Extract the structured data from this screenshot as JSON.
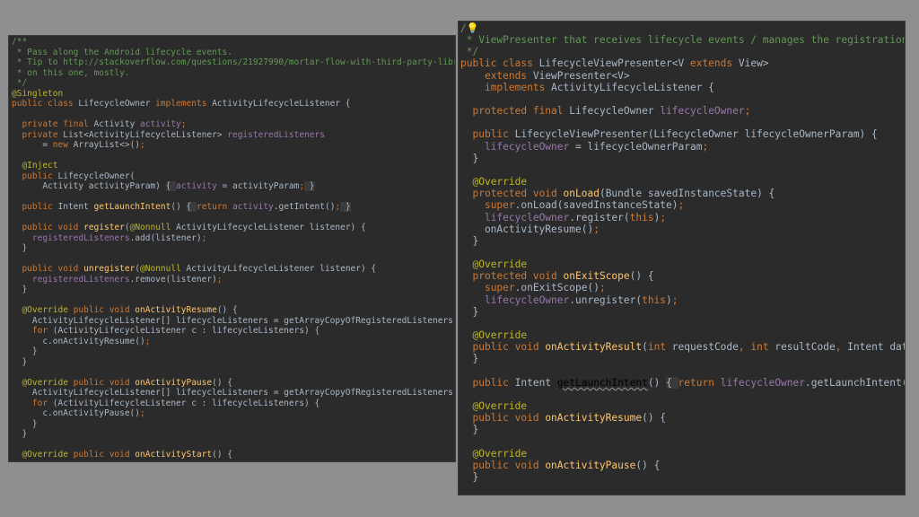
{
  "left": {
    "lines": [
      [
        [
          "/**",
          "cm"
        ]
      ],
      [
        [
          " * Pass along the Android lifecycle events.",
          "cm"
        ]
      ],
      [
        [
          " * Tip to http://stackoverflow.com/questions/21927990/mortar-flow-with-third-party-librarie",
          "cm"
        ]
      ],
      [
        [
          " * on this one, mostly.",
          "cm"
        ]
      ],
      [
        [
          " */",
          "cm"
        ]
      ],
      [
        [
          "@Singleton",
          "an"
        ]
      ],
      [
        [
          "public class ",
          "kw"
        ],
        [
          "LifecycleOwner ",
          "tx"
        ],
        [
          "implements ",
          "kw"
        ],
        [
          "ActivityLifecycleListener {",
          "tx"
        ]
      ],
      [
        [
          "",
          "tx"
        ]
      ],
      [
        [
          "  ",
          "tx"
        ],
        [
          "private final ",
          "kw"
        ],
        [
          "Activity ",
          "tx"
        ],
        [
          "activity",
          "fd"
        ],
        [
          ";",
          "kw"
        ]
      ],
      [
        [
          "  ",
          "tx"
        ],
        [
          "private ",
          "kw"
        ],
        [
          "List<ActivityLifecycleListener> ",
          "tx"
        ],
        [
          "registeredListeners",
          "fd"
        ]
      ],
      [
        [
          "      = ",
          "tx"
        ],
        [
          "new ",
          "kw"
        ],
        [
          "ArrayList<>()",
          "tx"
        ],
        [
          ";",
          "kw"
        ]
      ],
      [
        [
          "",
          "tx"
        ]
      ],
      [
        [
          "  ",
          "tx"
        ],
        [
          "@Inject",
          "an"
        ]
      ],
      [
        [
          "  ",
          "tx"
        ],
        [
          "public ",
          "kw"
        ],
        [
          "LifecycleOwner(",
          "tx"
        ]
      ],
      [
        [
          "      Activity activityParam) ",
          "tx"
        ],
        [
          "{ ",
          "fold"
        ],
        [
          "activity",
          "fd"
        ],
        [
          " = activityParam",
          "tx"
        ],
        [
          ";",
          "kw"
        ],
        [
          " }",
          "fold"
        ]
      ],
      [
        [
          "",
          "tx"
        ]
      ],
      [
        [
          "  ",
          "tx"
        ],
        [
          "public ",
          "kw"
        ],
        [
          "Intent ",
          "tx"
        ],
        [
          "getLaunchIntent",
          "fn"
        ],
        [
          "() ",
          "tx"
        ],
        [
          "{ ",
          "fold"
        ],
        [
          "return ",
          "kw"
        ],
        [
          "activity",
          "fd"
        ],
        [
          ".getIntent()",
          "tx"
        ],
        [
          ";",
          "kw"
        ],
        [
          " }",
          "fold"
        ]
      ],
      [
        [
          "",
          "tx"
        ]
      ],
      [
        [
          "  ",
          "tx"
        ],
        [
          "public void ",
          "kw"
        ],
        [
          "register",
          "fn"
        ],
        [
          "(",
          "tx"
        ],
        [
          "@Nonnull ",
          "an"
        ],
        [
          "ActivityLifecycleListener listener) {",
          "tx"
        ]
      ],
      [
        [
          "    ",
          "tx"
        ],
        [
          "registeredListeners",
          "fd"
        ],
        [
          ".add(listener)",
          "tx"
        ],
        [
          ";",
          "kw"
        ]
      ],
      [
        [
          "  }",
          "tx"
        ]
      ],
      [
        [
          "",
          "tx"
        ]
      ],
      [
        [
          "  ",
          "tx"
        ],
        [
          "public void ",
          "kw"
        ],
        [
          "unregister",
          "fn"
        ],
        [
          "(",
          "tx"
        ],
        [
          "@Nonnull ",
          "an"
        ],
        [
          "ActivityLifecycleListener listener) {",
          "tx"
        ]
      ],
      [
        [
          "    ",
          "tx"
        ],
        [
          "registeredListeners",
          "fd"
        ],
        [
          ".remove(listener)",
          "tx"
        ],
        [
          ";",
          "kw"
        ]
      ],
      [
        [
          "  }",
          "tx"
        ]
      ],
      [
        [
          "",
          "tx"
        ]
      ],
      [
        [
          "  ",
          "tx"
        ],
        [
          "@Override ",
          "an"
        ],
        [
          "public void ",
          "kw"
        ],
        [
          "onActivityResume",
          "fn"
        ],
        [
          "() {",
          "tx"
        ]
      ],
      [
        [
          "    ActivityLifecycleListener[] lifecycleListeners = getArrayCopyOfRegisteredListeners()",
          "tx"
        ],
        [
          ";",
          "kw"
        ]
      ],
      [
        [
          "    ",
          "tx"
        ],
        [
          "for ",
          "kw"
        ],
        [
          "(ActivityLifecycleListener c : lifecycleListeners) {",
          "tx"
        ]
      ],
      [
        [
          "      c.onActivityResume()",
          "tx"
        ],
        [
          ";",
          "kw"
        ]
      ],
      [
        [
          "    }",
          "tx"
        ]
      ],
      [
        [
          "  }",
          "tx"
        ]
      ],
      [
        [
          "",
          "tx"
        ]
      ],
      [
        [
          "  ",
          "tx"
        ],
        [
          "@Override ",
          "an"
        ],
        [
          "public void ",
          "kw"
        ],
        [
          "onActivityPause",
          "fn"
        ],
        [
          "() {",
          "tx"
        ]
      ],
      [
        [
          "    ActivityLifecycleListener[] lifecycleListeners = getArrayCopyOfRegisteredListeners()",
          "tx"
        ],
        [
          ";",
          "kw"
        ]
      ],
      [
        [
          "    ",
          "tx"
        ],
        [
          "for ",
          "kw"
        ],
        [
          "(ActivityLifecycleListener c : lifecycleListeners) {",
          "tx"
        ]
      ],
      [
        [
          "      c.onActivityPause()",
          "tx"
        ],
        [
          ";",
          "kw"
        ]
      ],
      [
        [
          "    }",
          "tx"
        ]
      ],
      [
        [
          "  }",
          "tx"
        ]
      ],
      [
        [
          "",
          "tx"
        ]
      ],
      [
        [
          "  ",
          "tx"
        ],
        [
          "@Override ",
          "an"
        ],
        [
          "public void ",
          "kw"
        ],
        [
          "onActivityStart",
          "fn"
        ],
        [
          "() {",
          "tx"
        ]
      ]
    ]
  },
  "right": {
    "lines": [
      [
        [
          "/",
          "cm"
        ],
        [
          "💡",
          "bulb"
        ]
      ],
      [
        [
          " * ViewPresenter that receives lifecycle events / manages the registration",
          "cm"
        ],
        [
          "",
          "caret"
        ]
      ],
      [
        [
          " */",
          "cm"
        ]
      ],
      [
        [
          "public class ",
          "kw"
        ],
        [
          "LifecycleViewPresenter<",
          "tx"
        ],
        [
          "V ",
          "ty"
        ],
        [
          "extends ",
          "kw"
        ],
        [
          "View>",
          "tx"
        ]
      ],
      [
        [
          "    ",
          "tx"
        ],
        [
          "extends ",
          "kw"
        ],
        [
          "ViewPresenter<",
          "tx"
        ],
        [
          "V",
          "ty"
        ],
        [
          ">",
          "tx"
        ]
      ],
      [
        [
          "    ",
          "tx"
        ],
        [
          "implements ",
          "kw"
        ],
        [
          "ActivityLifecycleListener {",
          "tx"
        ]
      ],
      [
        [
          "",
          "tx"
        ]
      ],
      [
        [
          "  ",
          "tx"
        ],
        [
          "protected final ",
          "kw"
        ],
        [
          "LifecycleOwner ",
          "tx"
        ],
        [
          "lifecycleOwner",
          "fd"
        ],
        [
          ";",
          "kw"
        ]
      ],
      [
        [
          "",
          "tx"
        ]
      ],
      [
        [
          "  ",
          "tx"
        ],
        [
          "public ",
          "kw"
        ],
        [
          "LifecycleViewPresenter(LifecycleOwner lifecycleOwnerParam) {",
          "tx"
        ]
      ],
      [
        [
          "    ",
          "tx"
        ],
        [
          "lifecycleOwner",
          "fd"
        ],
        [
          " = lifecycleOwnerParam",
          "tx"
        ],
        [
          ";",
          "kw"
        ]
      ],
      [
        [
          "  }",
          "tx"
        ]
      ],
      [
        [
          "",
          "tx"
        ]
      ],
      [
        [
          "  ",
          "tx"
        ],
        [
          "@Override",
          "an"
        ]
      ],
      [
        [
          "  ",
          "tx"
        ],
        [
          "protected void ",
          "kw"
        ],
        [
          "onLoad",
          "fn"
        ],
        [
          "(Bundle savedInstanceState) {",
          "tx"
        ]
      ],
      [
        [
          "    ",
          "tx"
        ],
        [
          "super",
          "kw"
        ],
        [
          ".onLoad(savedInstanceState)",
          "tx"
        ],
        [
          ";",
          "kw"
        ]
      ],
      [
        [
          "    ",
          "tx"
        ],
        [
          "lifecycleOwner",
          "fd"
        ],
        [
          ".register(",
          "tx"
        ],
        [
          "this",
          "kw"
        ],
        [
          ")",
          "tx"
        ],
        [
          ";",
          "kw"
        ]
      ],
      [
        [
          "    onActivityResume()",
          "tx"
        ],
        [
          ";",
          "kw"
        ]
      ],
      [
        [
          "  }",
          "tx"
        ]
      ],
      [
        [
          "",
          "tx"
        ]
      ],
      [
        [
          "  ",
          "tx"
        ],
        [
          "@Override",
          "an"
        ]
      ],
      [
        [
          "  ",
          "tx"
        ],
        [
          "protected void ",
          "kw"
        ],
        [
          "onExitScope",
          "fn"
        ],
        [
          "() {",
          "tx"
        ]
      ],
      [
        [
          "    ",
          "tx"
        ],
        [
          "super",
          "kw"
        ],
        [
          ".onExitScope()",
          "tx"
        ],
        [
          ";",
          "kw"
        ]
      ],
      [
        [
          "    ",
          "tx"
        ],
        [
          "lifecycleOwner",
          "fd"
        ],
        [
          ".unregister(",
          "tx"
        ],
        [
          "this",
          "kw"
        ],
        [
          ")",
          "tx"
        ],
        [
          ";",
          "kw"
        ]
      ],
      [
        [
          "  }",
          "tx"
        ]
      ],
      [
        [
          "",
          "tx"
        ]
      ],
      [
        [
          "  ",
          "tx"
        ],
        [
          "@Override",
          "an"
        ]
      ],
      [
        [
          "  ",
          "tx"
        ],
        [
          "public void ",
          "kw"
        ],
        [
          "onActivityResult",
          "fn"
        ],
        [
          "(",
          "tx"
        ],
        [
          "int ",
          "kw"
        ],
        [
          "requestCode",
          "tx"
        ],
        [
          ", ",
          "kw"
        ],
        [
          "int ",
          "kw"
        ],
        [
          "resultCode",
          "tx"
        ],
        [
          ", ",
          "kw"
        ],
        [
          "Intent data) {",
          "tx"
        ]
      ],
      [
        [
          "  }",
          "tx"
        ]
      ],
      [
        [
          "",
          "tx"
        ]
      ],
      [
        [
          "  ",
          "tx"
        ],
        [
          "public ",
          "kw"
        ],
        [
          "Intent ",
          "tx"
        ],
        [
          "getLaunchIntent",
          "ul"
        ],
        [
          "() ",
          "tx"
        ],
        [
          "{ ",
          "fold"
        ],
        [
          "return ",
          "kw"
        ],
        [
          "lifecycleOwner",
          "fd"
        ],
        [
          ".getLaunchIntent()",
          "tx"
        ],
        [
          ";",
          "kw"
        ],
        [
          " }",
          "fold"
        ]
      ],
      [
        [
          "",
          "tx"
        ]
      ],
      [
        [
          "  ",
          "tx"
        ],
        [
          "@Override",
          "an"
        ]
      ],
      [
        [
          "  ",
          "tx"
        ],
        [
          "public void ",
          "kw"
        ],
        [
          "onActivityResume",
          "fn"
        ],
        [
          "() {",
          "tx"
        ]
      ],
      [
        [
          "  }",
          "tx"
        ]
      ],
      [
        [
          "",
          "tx"
        ]
      ],
      [
        [
          "  ",
          "tx"
        ],
        [
          "@Override",
          "an"
        ]
      ],
      [
        [
          "  ",
          "tx"
        ],
        [
          "public void ",
          "kw"
        ],
        [
          "onActivityPause",
          "fn"
        ],
        [
          "() {",
          "tx"
        ]
      ],
      [
        [
          "  }",
          "tx"
        ]
      ]
    ]
  },
  "colors": {
    "background": "#8f8f8f",
    "editor_bg": "#2b2b2b",
    "keyword": "#cc7832",
    "comment": "#629755",
    "annotation": "#bbb529",
    "method": "#ffc66d",
    "field": "#9876aa",
    "text": "#a9b7c6"
  }
}
